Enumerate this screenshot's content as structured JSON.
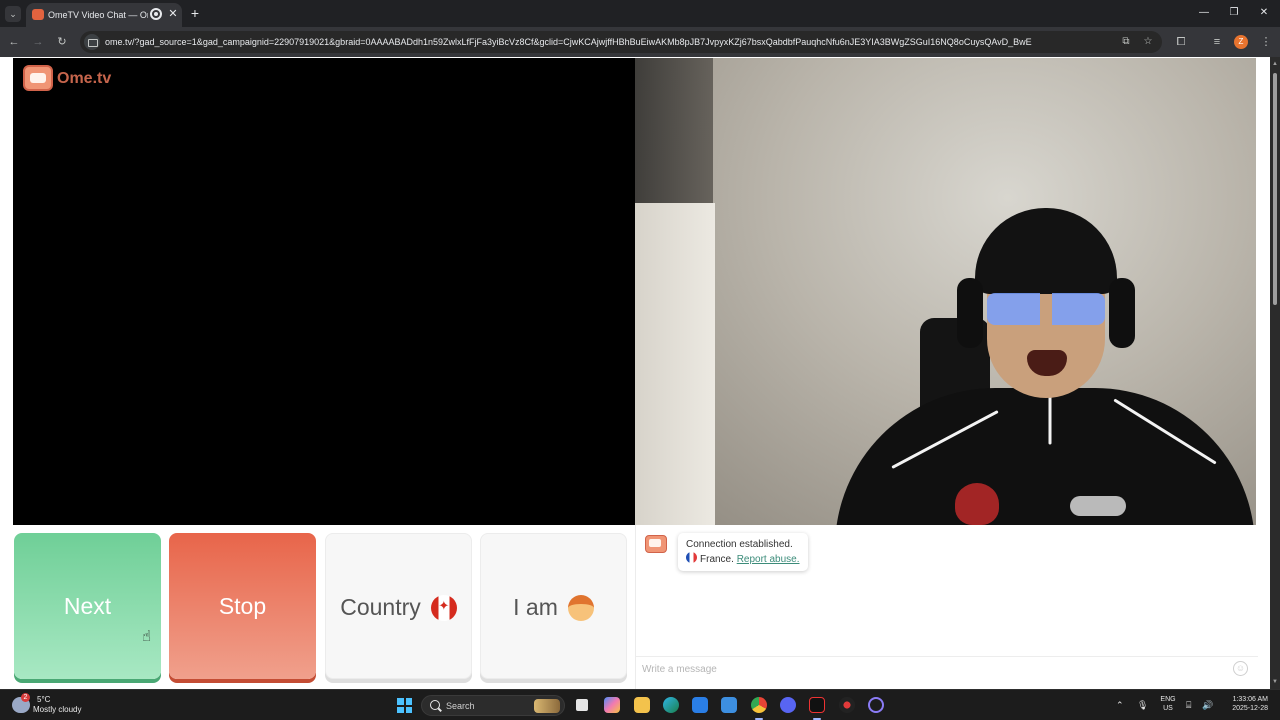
{
  "browser": {
    "tab_title": "OmeTV Video Chat — Omegle",
    "url": "ome.tv/?gad_source=1&gad_campaignid=22907919021&gbraid=0AAAABADdh1n59ZwlxLfFjFa3yiBcVz8Cf&gclid=CjwKCAjwjffHBhBuEiwAKMb8pJB7JvpyxKZj67bsxQabdbfPauqhcNfu6nJE3YIA3BWgZSGuI16NQ8oCuysQAvD_BwE",
    "profile_initial": "Z",
    "icons": [
      "tab-list-icon",
      "close-icon",
      "new-tab-icon",
      "back-icon",
      "forward-icon",
      "reload-icon",
      "install-app-icon",
      "bookmark-star-icon",
      "extensions-icon",
      "media-controls-icon",
      "menu-icon",
      "minimize-icon",
      "maximize-icon",
      "close-window-icon"
    ]
  },
  "page": {
    "logo_text": "Ome.tv",
    "controls": {
      "next_label": "Next",
      "stop_label": "Stop",
      "country_label": "Country",
      "iam_label": "I am"
    },
    "chat": {
      "status_message": "Connection established.",
      "partner_country": "France.",
      "report_link": "Report abuse.",
      "input_placeholder": "Write a message"
    },
    "colors": {
      "next": "#6fcf97",
      "stop": "#e8654a",
      "link": "#3c8c7a"
    }
  },
  "taskbar": {
    "weather_temp": "5°C",
    "weather_desc": "Mostly cloudy",
    "weather_badge": "2",
    "search_label": "Search",
    "lang_top": "ENG",
    "lang_bottom": "US",
    "time": "1:33:06 AM",
    "date": "2025-12-28"
  }
}
